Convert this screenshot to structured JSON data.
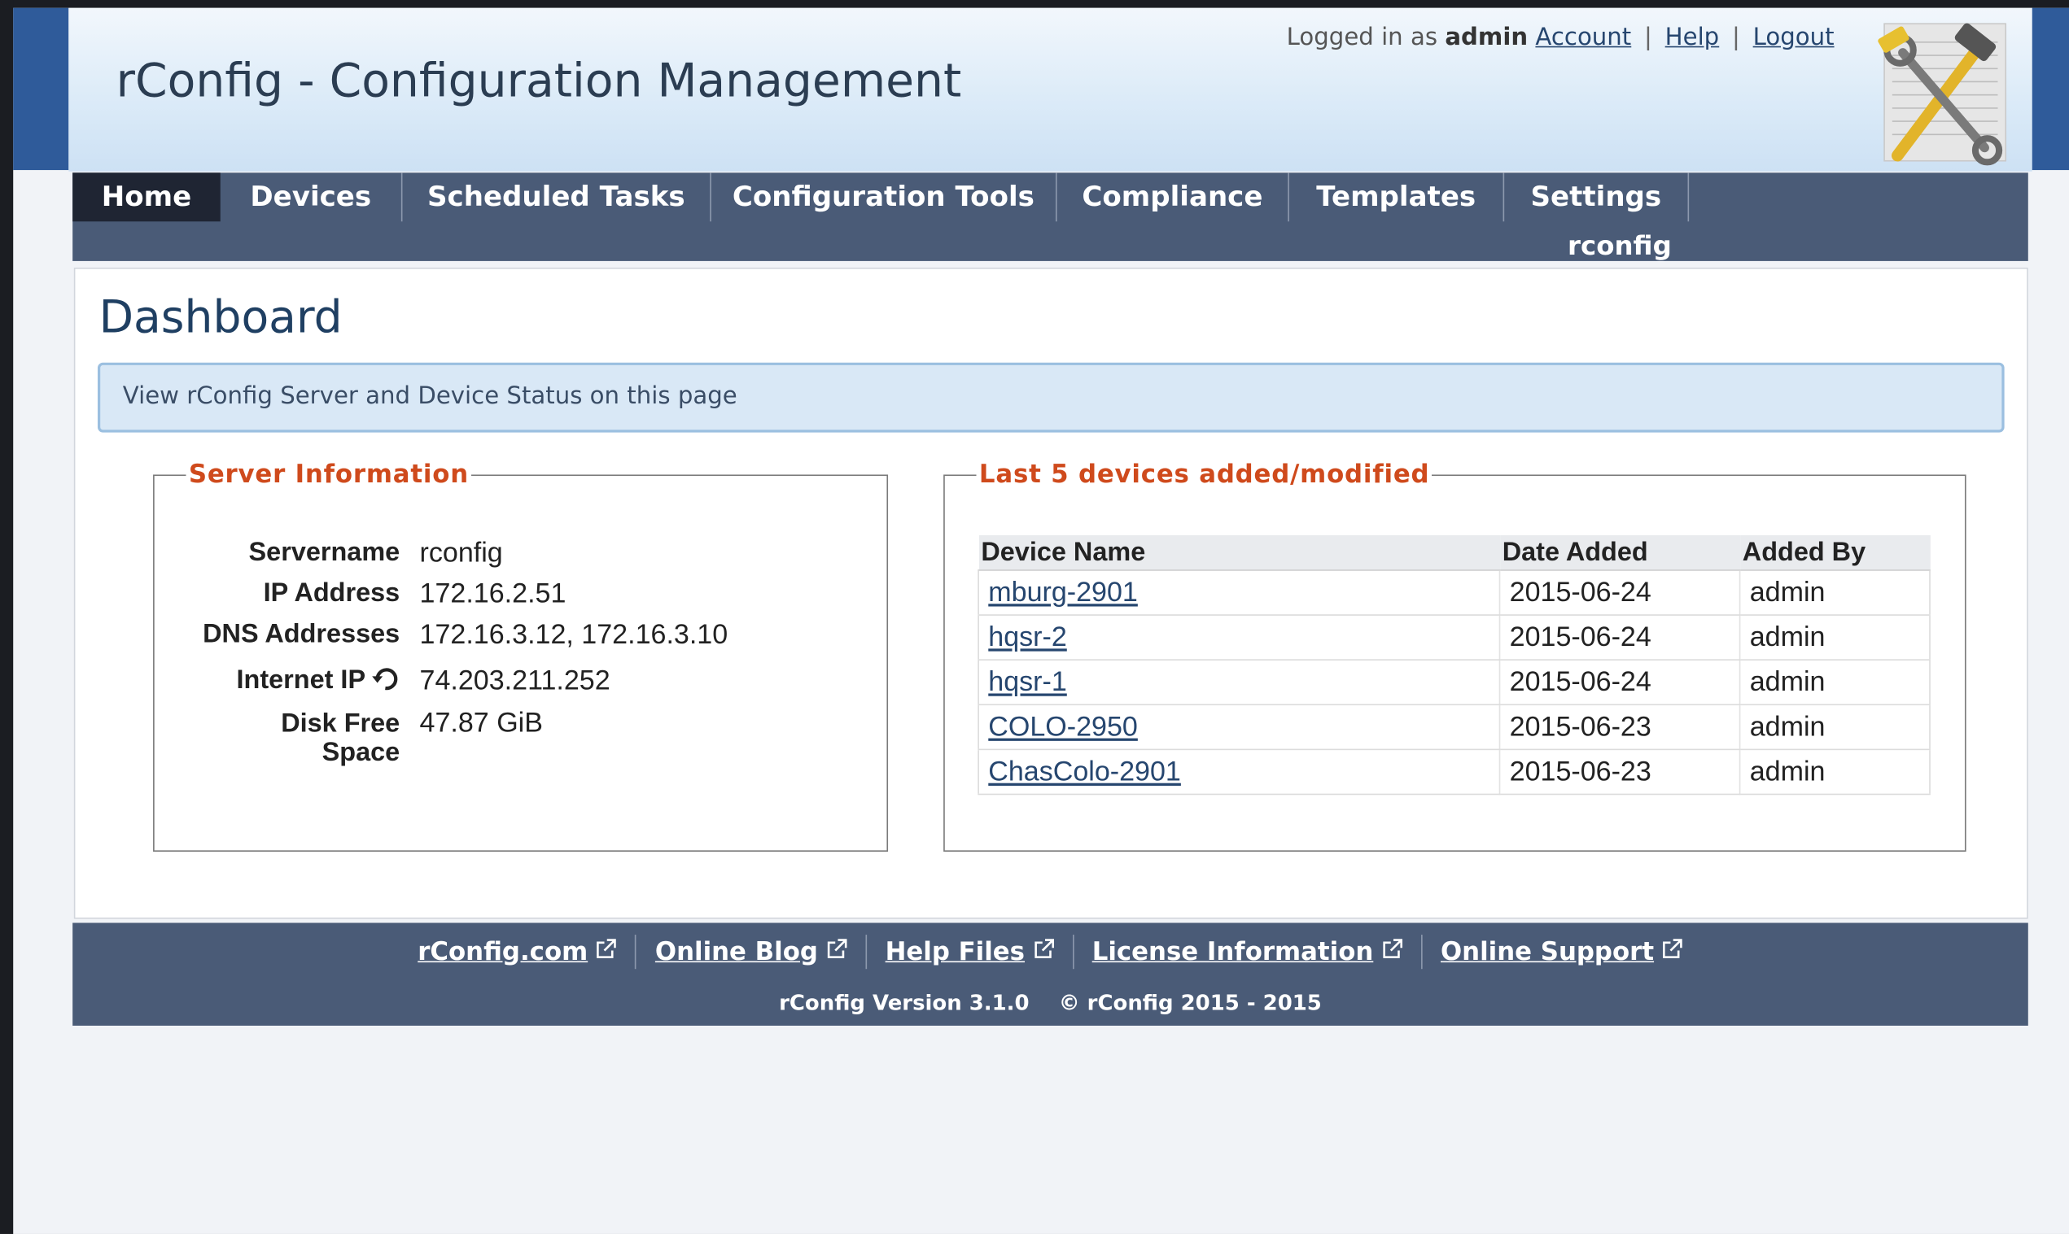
{
  "header": {
    "title": "rConfig - Configuration Management",
    "logged_in_prefix": "Logged in as",
    "username": "admin",
    "account_link": "Account",
    "help_link": "Help",
    "logout_link": "Logout",
    "separator": "|"
  },
  "nav": {
    "items": [
      {
        "label": "Home",
        "active": true
      },
      {
        "label": "Devices"
      },
      {
        "label": "Scheduled Tasks"
      },
      {
        "label": "Configuration Tools"
      },
      {
        "label": "Compliance"
      },
      {
        "label": "Templates"
      },
      {
        "label": "Settings"
      }
    ],
    "sub_label": "rconfig"
  },
  "main": {
    "title": "Dashboard",
    "info_text": "View rConfig Server and Device Status on this page"
  },
  "server_info": {
    "legend": "Server Information",
    "rows": [
      {
        "label": "Servername",
        "value": "rconfig"
      },
      {
        "label": "IP Address",
        "value": "172.16.2.51"
      },
      {
        "label": "DNS Addresses",
        "value": "172.16.3.12, 172.16.3.10"
      },
      {
        "label": "Internet IP",
        "value": "74.203.211.252"
      },
      {
        "label": "Disk Free Space",
        "value": "47.87 GiB"
      }
    ]
  },
  "devices": {
    "legend": "Last 5 devices added/modified",
    "columns": [
      "Device Name",
      "Date Added",
      "Added By"
    ],
    "rows": [
      {
        "name": "mburg-2901",
        "date": "2015-06-24",
        "by": "admin"
      },
      {
        "name": "hqsr-2",
        "date": "2015-06-24",
        "by": "admin"
      },
      {
        "name": "hqsr-1",
        "date": "2015-06-24",
        "by": "admin"
      },
      {
        "name": "COLO-2950",
        "date": "2015-06-23",
        "by": "admin"
      },
      {
        "name": "ChasColo-2901",
        "date": "2015-06-23",
        "by": "admin"
      }
    ]
  },
  "footer": {
    "links": [
      "rConfig.com",
      "Online Blog",
      "Help Files",
      "License Information",
      "Online Support"
    ],
    "version": "rConfig Version 3.1.0",
    "copyright": "© rConfig 2015 - 2015"
  },
  "colors": {
    "nav_bg": "#4a5b77",
    "nav_active": "#1f2533",
    "legend": "#cf4a1c",
    "link": "#26466f",
    "info_bg": "#d9e8f6"
  },
  "icons": {
    "logo": "hammer-wrench-logo-icon",
    "refresh": "refresh-icon",
    "external": "external-link-icon"
  }
}
